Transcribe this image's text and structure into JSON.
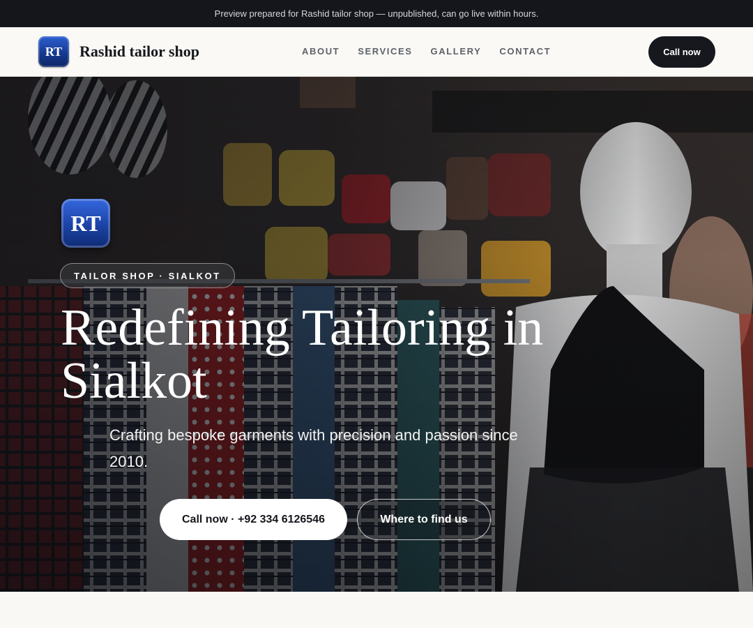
{
  "banner": {
    "text": "Preview prepared for Rashid tailor shop — unpublished, can go live within hours."
  },
  "nav": {
    "logo_text": "RT",
    "brand": "Rashid tailor shop",
    "links": [
      "ABOUT",
      "SERVICES",
      "GALLERY",
      "CONTACT"
    ],
    "cta": "Call now"
  },
  "hero": {
    "logo_text": "RT",
    "badge": "TAILOR SHOP · SIALKOT",
    "title": "Redefining Tailoring in Sialkot",
    "subtitle": "Crafting bespoke garments with precision and passion since 2010.",
    "primary_button": "Call now · +92 334 6126546",
    "secondary_button": "Where to find us",
    "background_image": "clothing-store-mannequin-photo"
  },
  "colors": {
    "dark": "#16181d",
    "logo_blue": "#1b43a5",
    "page_bg": "#f9f8f5"
  }
}
